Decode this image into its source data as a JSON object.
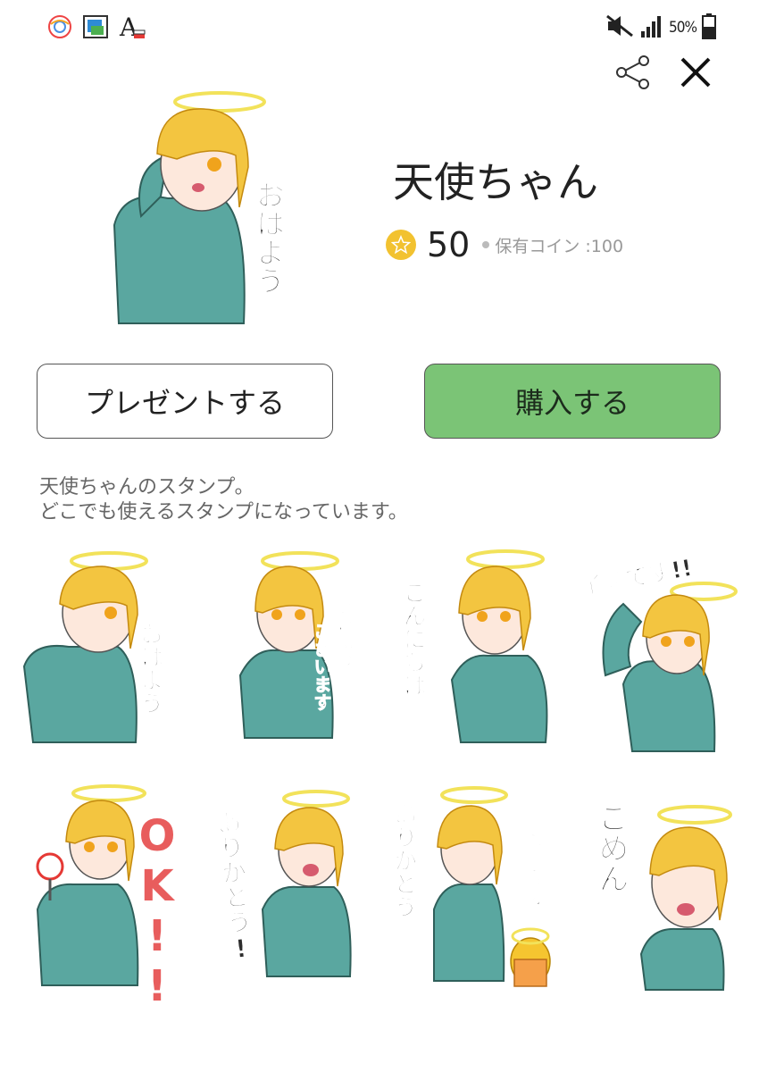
{
  "status_bar": {
    "left_icons": [
      "chrome-like-icon",
      "gallery-icon",
      "font-icon"
    ],
    "right_icons": [
      "mute-icon",
      "signal-icon",
      "battery-icon"
    ],
    "battery": "50%"
  },
  "actions": {
    "share_icon": "share-icon",
    "close_icon": "close-icon"
  },
  "product": {
    "title": "天使ちゃん",
    "price": "50",
    "owned_coins": "保有コイン :100",
    "hero_caption": "おはよう"
  },
  "buttons": {
    "present": "プレゼントする",
    "buy": "購入する"
  },
  "description": {
    "line1": "天使ちゃんのスタンプ。",
    "line2": "どこでも使えるスタンプになっています。"
  },
  "stickers": [
    {
      "caption": "おはよう"
    },
    {
      "caption": "おはよう",
      "caption2": "ございます"
    },
    {
      "caption": "こんにちは"
    },
    {
      "caption": "了解です!!"
    },
    {
      "caption": "OK!!"
    },
    {
      "caption": "ありがとう!"
    },
    {
      "caption": "ありがとう",
      "caption2": "ございます"
    },
    {
      "caption": "ごめん"
    }
  ],
  "colors": {
    "buy_button": "#7bc476",
    "coin": "#f2c230",
    "hair": "#f3c540",
    "shirt": "#5aa7a0",
    "halo": "#f2e25a"
  }
}
